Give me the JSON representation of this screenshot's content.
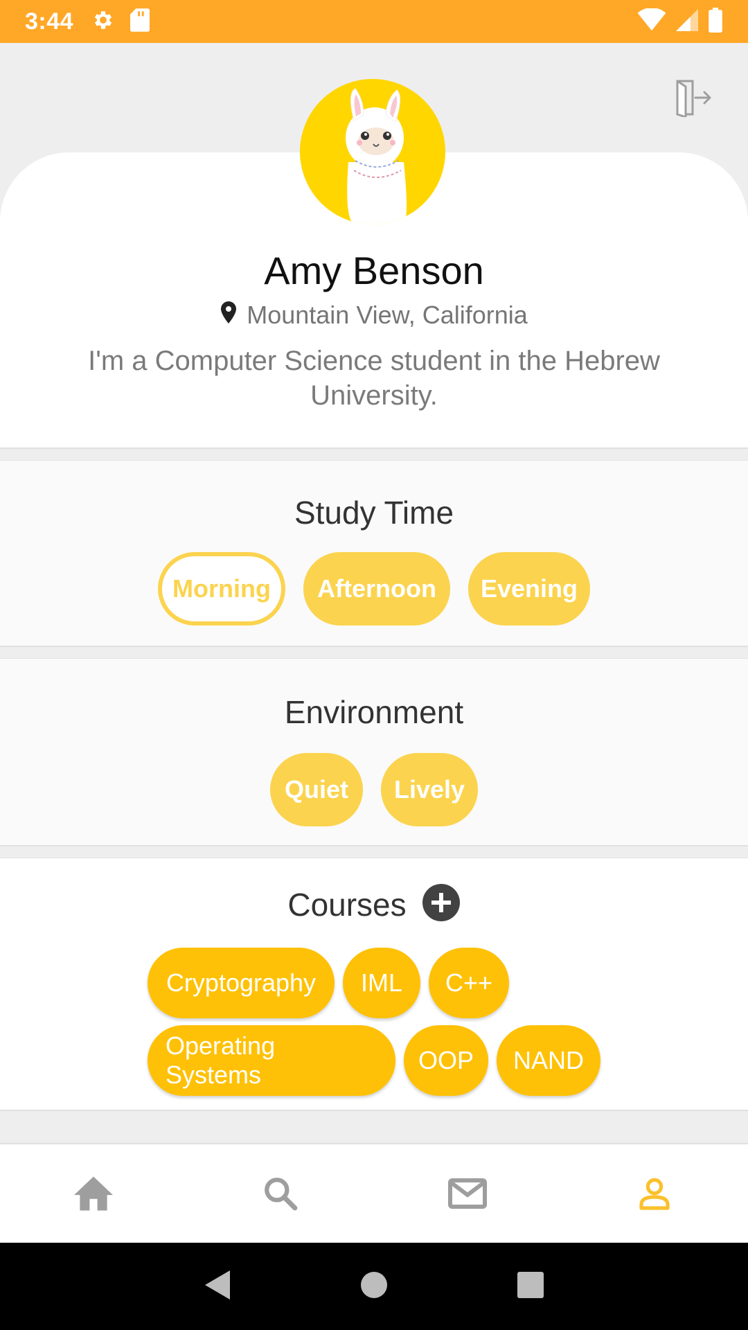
{
  "status_bar": {
    "time": "3:44"
  },
  "profile": {
    "name": "Amy Benson",
    "location": "Mountain View, California",
    "bio": "I'm a Computer Science student in the Hebrew University."
  },
  "study_time": {
    "title": "Study Time",
    "chips": [
      {
        "label": "Morning",
        "selected": false
      },
      {
        "label": "Afternoon",
        "selected": true
      },
      {
        "label": "Evening",
        "selected": true
      }
    ]
  },
  "environment": {
    "title": "Environment",
    "chips": [
      {
        "label": "Quiet"
      },
      {
        "label": "Lively"
      }
    ]
  },
  "courses": {
    "title": "Courses",
    "items": [
      "Cryptography",
      "IML",
      "C++",
      "Operating Systems",
      "OOP",
      "NAND"
    ]
  },
  "colors": {
    "status_bar": "#FFA726",
    "chip": "#FBD34E",
    "course_chip": "#FFC107",
    "active_nav": "#FBC02D",
    "inactive_nav": "#9E9E9E"
  },
  "nav": {
    "items": [
      {
        "icon": "home-icon",
        "active": false
      },
      {
        "icon": "search-icon",
        "active": false
      },
      {
        "icon": "mail-icon",
        "active": false
      },
      {
        "icon": "profile-icon",
        "active": true
      }
    ]
  }
}
